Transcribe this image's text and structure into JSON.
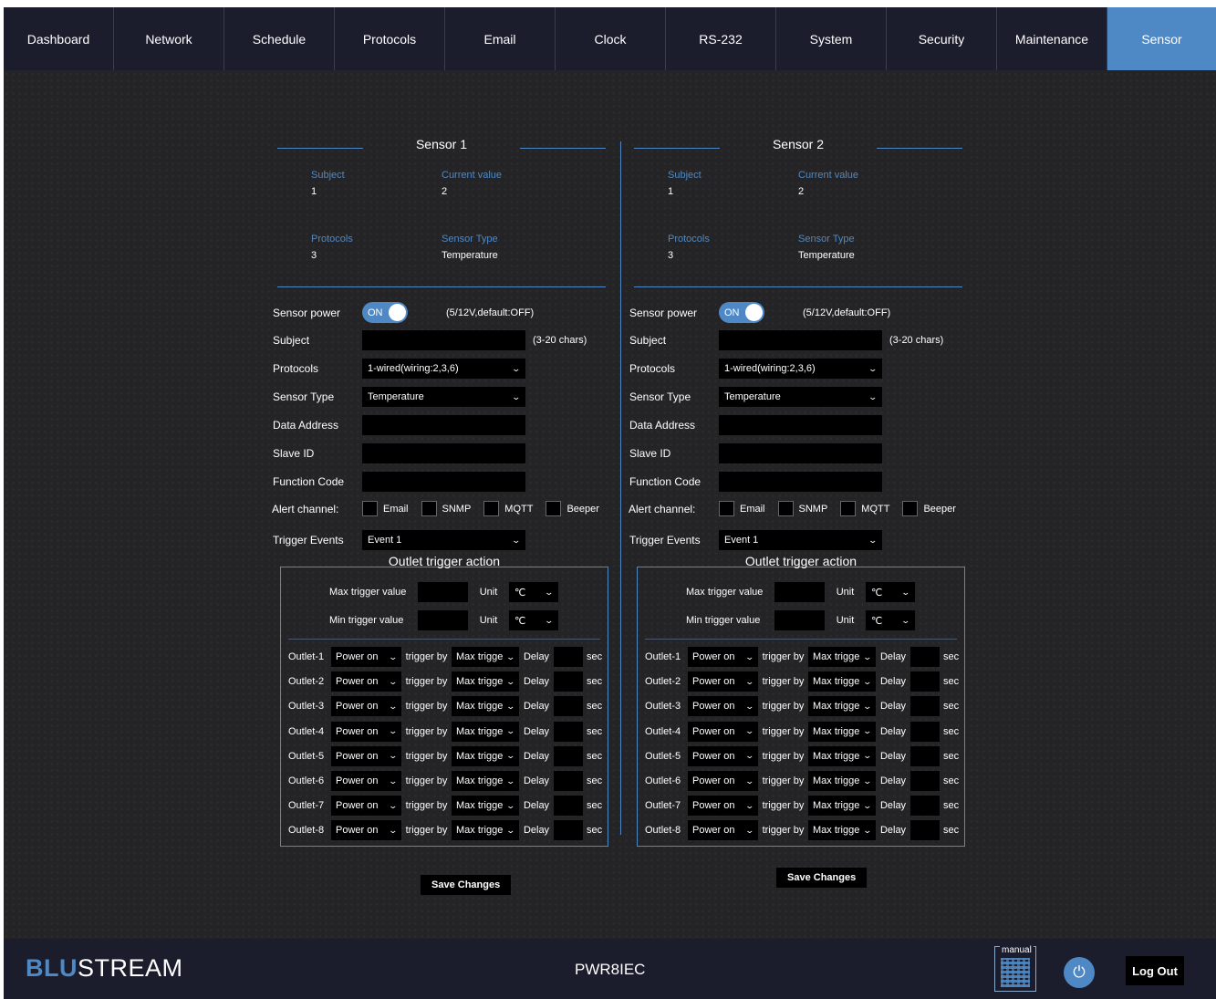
{
  "nav": {
    "tabs": [
      "Dashboard",
      "Network",
      "Schedule",
      "Protocols",
      "Email",
      "Clock",
      "RS-232",
      "System",
      "Security",
      "Maintenance",
      "Sensor"
    ],
    "active": "Sensor"
  },
  "sensors": [
    {
      "title": "Sensor 1",
      "info": {
        "subject_label": "Subject",
        "subject_value": "1",
        "current_label": "Current value",
        "current_value": "2",
        "protocols_label": "Protocols",
        "protocols_value": "3",
        "type_label": "Sensor Type",
        "type_value": "Temperature"
      },
      "form": {
        "power_label": "Sensor power",
        "power_state": "ON",
        "power_hint": "(5/12V,default:OFF)",
        "subject_label": "Subject",
        "subject_value": "",
        "subject_hint": "(3-20 chars)",
        "protocols_label": "Protocols",
        "protocols_value": "1-wired(wiring:2,3,6)",
        "type_label": "Sensor Type",
        "type_value": "Temperature",
        "address_label": "Data Address",
        "slave_label": "Slave ID",
        "function_label": "Function Code",
        "alert_label": "Alert channel:",
        "alerts": [
          "Email",
          "SNMP",
          "MQTT",
          "Beeper"
        ],
        "trigger_label": "Trigger Events",
        "trigger_value": "Event 1"
      },
      "outlet": {
        "title": "Outlet trigger action",
        "max_label": "Max trigger value",
        "min_label": "Min trigger value",
        "unit_label": "Unit",
        "unit_value": "℃",
        "rows": [
          {
            "name": "Outlet-1",
            "action": "Power on",
            "trigger": "trigger by",
            "by": "Max trigger",
            "delay": "Delay",
            "sec": "sec"
          },
          {
            "name": "Outlet-2",
            "action": "Power on",
            "trigger": "trigger by",
            "by": "Max trigger",
            "delay": "Delay",
            "sec": "sec"
          },
          {
            "name": "Outlet-3",
            "action": "Power on",
            "trigger": "trigger by",
            "by": "Max trigger",
            "delay": "Delay",
            "sec": "sec"
          },
          {
            "name": "Outlet-4",
            "action": "Power on",
            "trigger": "trigger by",
            "by": "Max trigger",
            "delay": "Delay",
            "sec": "sec"
          },
          {
            "name": "Outlet-5",
            "action": "Power on",
            "trigger": "trigger by",
            "by": "Max trigger",
            "delay": "Delay",
            "sec": "sec"
          },
          {
            "name": "Outlet-6",
            "action": "Power on",
            "trigger": "trigger by",
            "by": "Max trigger",
            "delay": "Delay",
            "sec": "sec"
          },
          {
            "name": "Outlet-7",
            "action": "Power on",
            "trigger": "trigger by",
            "by": "Max trigger",
            "delay": "Delay",
            "sec": "sec"
          },
          {
            "name": "Outlet-8",
            "action": "Power on",
            "trigger": "trigger by",
            "by": "Max trigger",
            "delay": "Delay",
            "sec": "sec"
          }
        ]
      },
      "save_label": "Save Changes"
    },
    {
      "title": "Sensor 2",
      "info": {
        "subject_label": "Subject",
        "subject_value": "1",
        "current_label": "Current value",
        "current_value": "2",
        "protocols_label": "Protocols",
        "protocols_value": "3",
        "type_label": "Sensor Type",
        "type_value": "Temperature"
      },
      "form": {
        "power_label": "Sensor power",
        "power_state": "ON",
        "power_hint": "(5/12V,default:OFF)",
        "subject_label": "Subject",
        "subject_value": "",
        "subject_hint": "(3-20 chars)",
        "protocols_label": "Protocols",
        "protocols_value": "1-wired(wiring:2,3,6)",
        "type_label": "Sensor Type",
        "type_value": "Temperature",
        "address_label": "Data Address",
        "slave_label": "Slave ID",
        "function_label": "Function Code",
        "alert_label": "Alert channel:",
        "alerts": [
          "Email",
          "SNMP",
          "MQTT",
          "Beeper"
        ],
        "trigger_label": "Trigger Events",
        "trigger_value": "Event 1"
      },
      "outlet": {
        "title": "Outlet trigger action",
        "max_label": "Max trigger value",
        "min_label": "Min trigger value",
        "unit_label": "Unit",
        "unit_value": "℃",
        "rows": [
          {
            "name": "Outlet-1",
            "action": "Power on",
            "trigger": "trigger by",
            "by": "Max trigger",
            "delay": "Delay",
            "sec": "sec"
          },
          {
            "name": "Outlet-2",
            "action": "Power on",
            "trigger": "trigger by",
            "by": "Max trigger",
            "delay": "Delay",
            "sec": "sec"
          },
          {
            "name": "Outlet-3",
            "action": "Power on",
            "trigger": "trigger by",
            "by": "Max trigger",
            "delay": "Delay",
            "sec": "sec"
          },
          {
            "name": "Outlet-4",
            "action": "Power on",
            "trigger": "trigger by",
            "by": "Max trigger",
            "delay": "Delay",
            "sec": "sec"
          },
          {
            "name": "Outlet-5",
            "action": "Power on",
            "trigger": "trigger by",
            "by": "Max trigger",
            "delay": "Delay",
            "sec": "sec"
          },
          {
            "name": "Outlet-6",
            "action": "Power on",
            "trigger": "trigger by",
            "by": "Max trigger",
            "delay": "Delay",
            "sec": "sec"
          },
          {
            "name": "Outlet-7",
            "action": "Power on",
            "trigger": "trigger by",
            "by": "Max trigger",
            "delay": "Delay",
            "sec": "sec"
          },
          {
            "name": "Outlet-8",
            "action": "Power on",
            "trigger": "trigger by",
            "by": "Max trigger",
            "delay": "Delay",
            "sec": "sec"
          }
        ]
      },
      "save_label": "Save Changes"
    }
  ],
  "footer": {
    "logo_blu": "BLU",
    "logo_stream": "STREAM",
    "model": "PWR8IEC",
    "manual_label": "manual",
    "logout_label": "Log Out"
  },
  "colors": {
    "accent": "#4f89c5",
    "nav_bg": "#1b1c2c",
    "page_bg": "#242426"
  }
}
